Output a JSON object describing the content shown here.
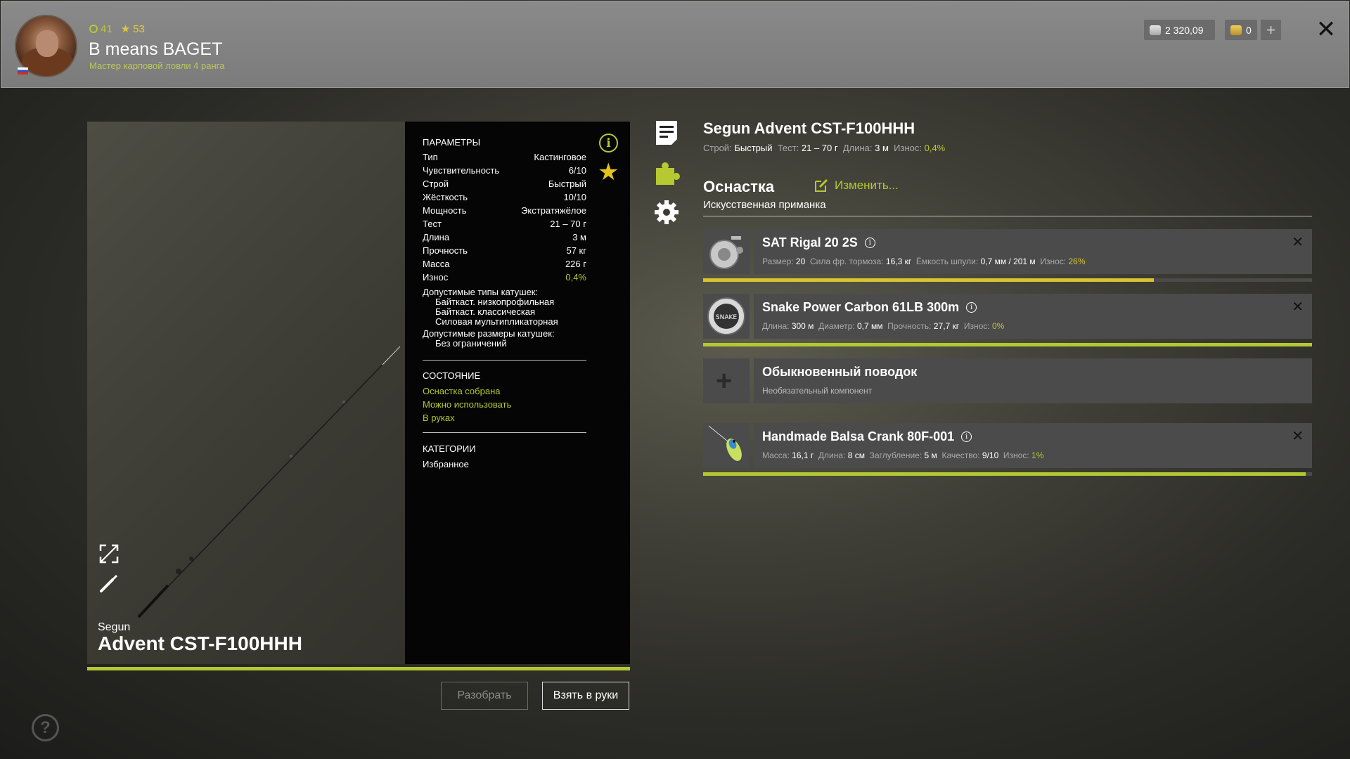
{
  "player": {
    "level": "41",
    "stars": "53",
    "name": "B means BAGET",
    "rank": "Мастер карповой ловли 4 ранга"
  },
  "currency": {
    "silver": "2 320,09",
    "gold": "0",
    "add": "+"
  },
  "close_label": "✕",
  "rod": {
    "brand": "Segun",
    "model": "Advent CST-F100HHH",
    "wear_fraction": 1.0
  },
  "params": {
    "header": "ПАРАМЕТРЫ",
    "rows": [
      {
        "label": "Тип",
        "value": "Кастинговое"
      },
      {
        "label": "Чувствительность",
        "value": "6/10"
      },
      {
        "label": "Строй",
        "value": "Быстрый"
      },
      {
        "label": "Жёсткость",
        "value": "10/10"
      },
      {
        "label": "Мощность",
        "value": "Экстратяжёлое"
      },
      {
        "label": "Тест",
        "value": "21 – 70 г"
      },
      {
        "label": "Длина",
        "value": "3 м"
      },
      {
        "label": "Прочность",
        "value": "57 кг"
      },
      {
        "label": "Масса",
        "value": "226 г"
      },
      {
        "label": "Износ",
        "value": "0,4%"
      }
    ],
    "reel_types_header": "Допустимые типы катушек:",
    "reel_types": [
      "Байткаст. низкопрофильная",
      "Байткаст. классическая",
      "Силовая мультипликаторная"
    ],
    "reel_sizes_header": "Допустимые размеры катушек:",
    "reel_sizes": [
      "Без ограничений"
    ],
    "state_header": "СОСТОЯНИЕ",
    "states": [
      "Оснастка собрана",
      "Можно использовать",
      "В руках"
    ],
    "categories_header": "КАТЕГОРИИ",
    "categories": [
      "Избранное"
    ]
  },
  "buttons": {
    "disassemble": "Разобрать",
    "take": "Взять в руки"
  },
  "tackle": {
    "title": "Segun Advent CST-F100HHH",
    "specs": {
      "action_label": "Строй:",
      "action": "Быстрый",
      "test_label": "Тест:",
      "test": "21 – 70 г",
      "length_label": "Длина:",
      "length": "3 м",
      "wear_label": "Износ:",
      "wear": "0,4%"
    },
    "rig_title": "Оснастка",
    "rig_edit": "Изменить...",
    "rig_type": "Искусственная приманка"
  },
  "slots": [
    {
      "name": "SAT Rigal 20 2S",
      "details": [
        {
          "label": "Размер:",
          "value": "20"
        },
        {
          "label": "Сила фр. тормоза:",
          "value": "16,3 кг"
        },
        {
          "label": "Ёмкость шпули:",
          "value": "0,7 мм / 201 м"
        },
        {
          "label": "Износ:",
          "value": "26%"
        }
      ],
      "bar_fraction": 0.74,
      "bar_color": "#d8c430"
    },
    {
      "name": "Snake Power Carbon 61LB 300m",
      "details": [
        {
          "label": "Длина:",
          "value": "300 м"
        },
        {
          "label": "Диаметр:",
          "value": "0,7 мм"
        },
        {
          "label": "Прочность:",
          "value": "27,7 кг"
        },
        {
          "label": "Износ:",
          "value": "0%"
        }
      ],
      "bar_fraction": 1.0,
      "bar_color": "#b4c832"
    },
    {
      "name": "Обыкновенный поводок",
      "subtitle": "Необязательный компонент"
    },
    {
      "name": "Handmade Balsa Crank 80F-001",
      "details": [
        {
          "label": "Масса:",
          "value": "16,1 г"
        },
        {
          "label": "Длина:",
          "value": "8 см"
        },
        {
          "label": "Заглубление:",
          "value": "5 м"
        },
        {
          "label": "Качество:",
          "value": "9/10"
        },
        {
          "label": "Износ:",
          "value": "1%"
        }
      ],
      "bar_fraction": 0.99,
      "bar_color": "#b4c832"
    }
  ],
  "colors": {
    "accent": "#b6c930",
    "star": "#e4c31a",
    "wear_warn": "#d8c430"
  }
}
